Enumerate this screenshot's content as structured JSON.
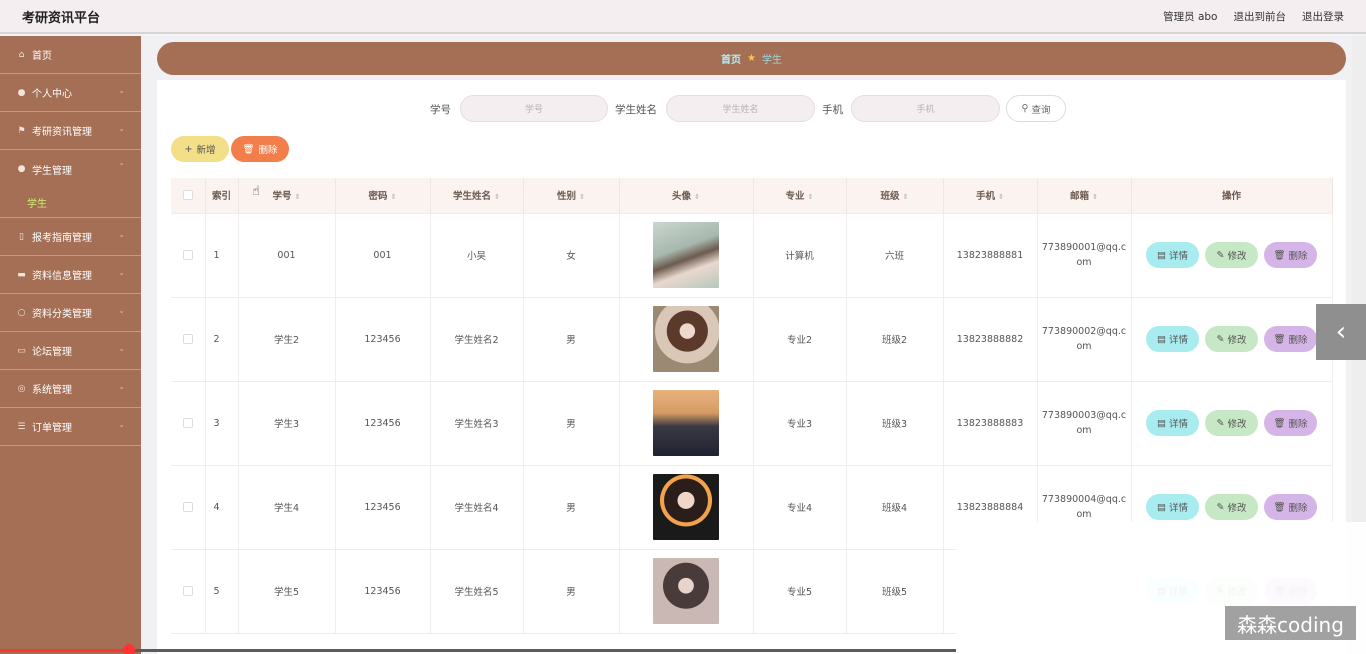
{
  "header": {
    "title": "考研资讯平台",
    "admin": "管理员 abo",
    "goto_front": "退出到前台",
    "logout": "退出登录"
  },
  "sidebar": {
    "items": [
      {
        "label": "首页",
        "icon": "home-icon",
        "glyph": "⌂"
      },
      {
        "label": "个人中心",
        "icon": "user-icon",
        "glyph": "●",
        "chevron": "⌄"
      },
      {
        "label": "考研资讯管理",
        "icon": "flag-icon",
        "glyph": "⚑",
        "chevron": "⌄"
      },
      {
        "label": "学生管理",
        "icon": "user-icon",
        "glyph": "●",
        "chevron": "⌃"
      },
      {
        "label": "报考指南管理",
        "icon": "book-icon",
        "glyph": "▯",
        "chevron": "⌄"
      },
      {
        "label": "资料信息管理",
        "icon": "chat-icon",
        "glyph": "▬",
        "chevron": "⌄"
      },
      {
        "label": "资料分类管理",
        "icon": "circle-icon",
        "glyph": "○",
        "chevron": "⌄"
      },
      {
        "label": "论坛管理",
        "icon": "monitor-icon",
        "glyph": "▭",
        "chevron": "⌄"
      },
      {
        "label": "系统管理",
        "icon": "globe-icon",
        "glyph": "◎",
        "chevron": "⌄"
      },
      {
        "label": "订单管理",
        "icon": "sliders-icon",
        "glyph": "☰",
        "chevron": "⌄"
      }
    ],
    "submenu_student": "学生"
  },
  "breadcrumb": {
    "home": "首页",
    "separator": "★",
    "current": "学生"
  },
  "search": {
    "student_no_label": "学号",
    "student_no_placeholder": "学号",
    "student_name_label": "学生姓名",
    "student_name_placeholder": "学生姓名",
    "phone_label": "手机",
    "phone_placeholder": "手机",
    "query_button": "查询"
  },
  "toolbar": {
    "add": "新增",
    "delete": "删除"
  },
  "table": {
    "headers": [
      "索引",
      "学号",
      "密码",
      "学生姓名",
      "性别",
      "头像",
      "专业",
      "班级",
      "手机",
      "邮箱",
      "操作"
    ],
    "rows": [
      {
        "index": "1",
        "student_no": "001",
        "password": "001",
        "name": "小吴",
        "gender": "女",
        "major": "计算机",
        "class": "六班",
        "phone": "13823888881",
        "email": "773890001@qq.com"
      },
      {
        "index": "2",
        "student_no": "学生2",
        "password": "123456",
        "name": "学生姓名2",
        "gender": "男",
        "major": "专业2",
        "class": "班级2",
        "phone": "13823888882",
        "email": "773890002@qq.com"
      },
      {
        "index": "3",
        "student_no": "学生3",
        "password": "123456",
        "name": "学生姓名3",
        "gender": "男",
        "major": "专业3",
        "class": "班级3",
        "phone": "13823888883",
        "email": "773890003@qq.com"
      },
      {
        "index": "4",
        "student_no": "学生4",
        "password": "123456",
        "name": "学生姓名4",
        "gender": "男",
        "major": "专业4",
        "class": "班级4",
        "phone": "13823888884",
        "email": "773890004@qq.com"
      },
      {
        "index": "5",
        "student_no": "学生5",
        "password": "123456",
        "name": "学生姓名5",
        "gender": "男",
        "major": "专业5",
        "class": "班级5",
        "phone": "",
        "email": ""
      }
    ],
    "actions": {
      "detail": "详情",
      "edit": "修改",
      "delete": "删除"
    }
  },
  "overlay": {
    "watermark": "森森coding",
    "arrow": "‹"
  },
  "video_progress": 0.135
}
